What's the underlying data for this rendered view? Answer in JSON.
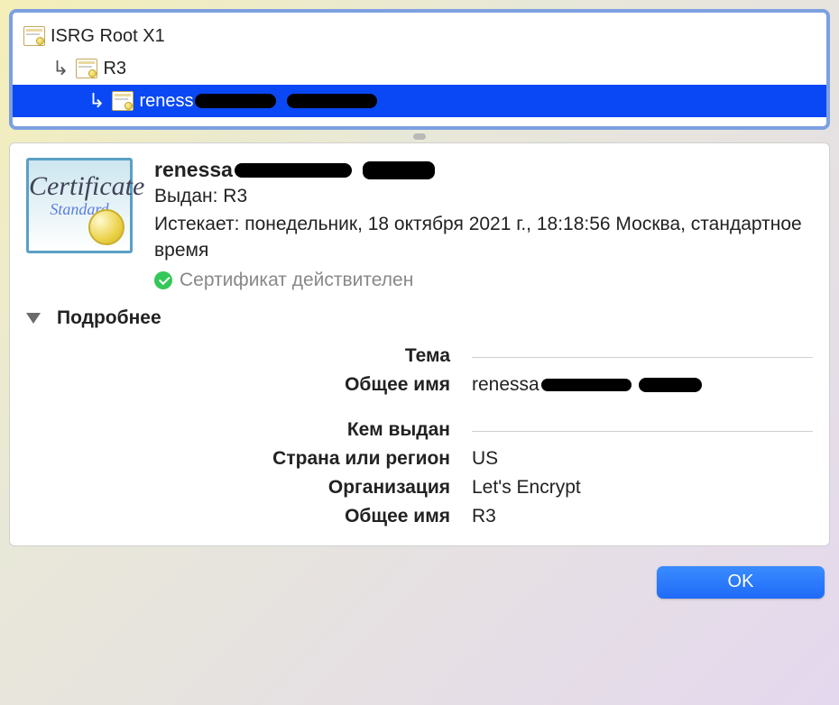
{
  "chain": {
    "root": "ISRG Root X1",
    "intermediate": "R3",
    "leaf_prefix": "reness"
  },
  "details": {
    "title_prefix": "renessa",
    "issued_label": "Выдан: R3",
    "expires": "Истекает: понедельник, 18 октября 2021 г., 18:18:56 Москва, стандартное время",
    "valid": "Сертификат действителен",
    "cert_icon_line1": "Certificate",
    "cert_icon_line2": "Standard"
  },
  "disclosure": {
    "label": "Подробнее"
  },
  "sections": {
    "subject": {
      "heading": "Тема",
      "common_name_label": "Общее имя",
      "common_name_prefix": "renessa"
    },
    "issuer": {
      "heading": "Кем выдан",
      "country_label": "Страна или регион",
      "country": "US",
      "org_label": "Организация",
      "org": "Let's Encrypt",
      "common_name_label": "Общее имя",
      "common_name": "R3"
    }
  },
  "buttons": {
    "ok": "OK"
  }
}
